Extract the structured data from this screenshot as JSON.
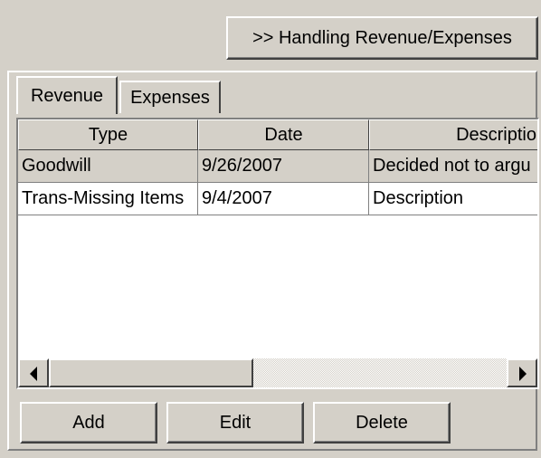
{
  "toolbar": {
    "handling_label": ">> Handling Revenue/Expenses"
  },
  "tabs": [
    {
      "label": "Revenue",
      "active": true
    },
    {
      "label": "Expenses",
      "active": false
    }
  ],
  "grid": {
    "columns": [
      "Type",
      "Date",
      "Descriptio"
    ],
    "rows": [
      {
        "type": "Goodwill",
        "date": "9/26/2007",
        "description": "Decided not to argu",
        "selected": true
      },
      {
        "type": "Trans-Missing Items",
        "date": "9/4/2007",
        "description": "Description",
        "selected": false
      }
    ]
  },
  "buttons": {
    "add": "Add",
    "edit": "Edit",
    "delete": "Delete"
  },
  "colors": {
    "face": "#d4d0c8",
    "highlight": "#ffffff",
    "shadow": "#808080",
    "dark_shadow": "#404040"
  }
}
